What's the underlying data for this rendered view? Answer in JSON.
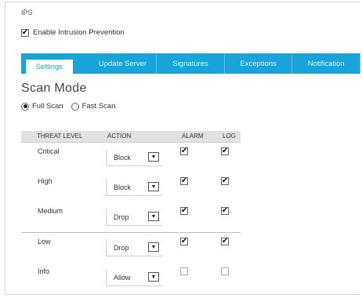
{
  "section_title": "IPS",
  "enable": {
    "label": "Enable Intrusion Prevention",
    "checked": true
  },
  "tabs": [
    {
      "label": "Settings",
      "active": true
    },
    {
      "label": "Update Server",
      "active": false
    },
    {
      "label": "Signatures",
      "active": false
    },
    {
      "label": "Exceptions",
      "active": false
    },
    {
      "label": "Notification",
      "active": false
    }
  ],
  "scan_mode": {
    "title": "Scan Mode",
    "options": [
      {
        "label": "Full Scan",
        "selected": true
      },
      {
        "label": "Fast Scan",
        "selected": false
      }
    ]
  },
  "table": {
    "headers": {
      "threat_level": "THREAT LEVEL",
      "action": "ACTION",
      "alarm": "ALARM",
      "log": "LOG"
    },
    "rows": [
      {
        "level": "Critical",
        "action": "Block",
        "alarm": true,
        "log": true
      },
      {
        "level": "High",
        "action": "Block",
        "alarm": true,
        "log": true
      },
      {
        "level": "Medium",
        "action": "Drop",
        "alarm": true,
        "log": true
      },
      {
        "level": "Low",
        "action": "Drop",
        "alarm": true,
        "log": true
      },
      {
        "level": "Info",
        "action": "Allow",
        "alarm": false,
        "log": false
      }
    ]
  },
  "colors": {
    "accent": "#18a3d9",
    "header_bg": "#e2e2e2"
  }
}
